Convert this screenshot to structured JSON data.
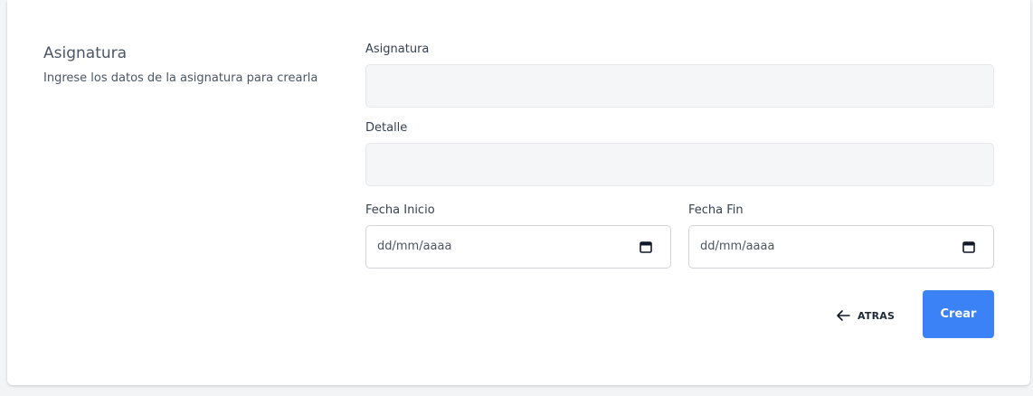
{
  "section": {
    "title": "Asignatura",
    "description": "Ingrese los datos de la asignatura para crearla"
  },
  "form": {
    "asignatura": {
      "label": "Asignatura",
      "value": ""
    },
    "detalle": {
      "label": "Detalle",
      "value": ""
    },
    "fecha_inicio": {
      "label": "Fecha Inicio",
      "placeholder": "dd/mm/aaaa"
    },
    "fecha_fin": {
      "label": "Fecha Fin",
      "placeholder": "dd/mm/aaaa"
    }
  },
  "actions": {
    "back_label": "ATRAS",
    "create_label": "Crear"
  },
  "colors": {
    "primary": "#3b82f6",
    "input_bg": "#f5f6f8",
    "background": "#f3f4f6"
  },
  "icons": {
    "back": "arrow-left-icon",
    "date": "calendar-icon"
  }
}
